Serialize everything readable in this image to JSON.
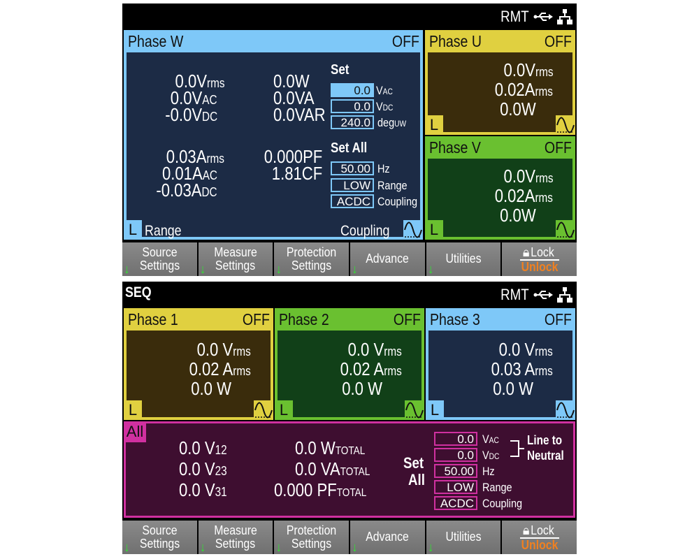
{
  "screen1": {
    "status": {
      "left": "",
      "remote": "RMT",
      "icons": [
        "usb-icon",
        "lan-icon"
      ]
    },
    "phase_w": {
      "title": "Phase W",
      "state": "OFF",
      "color": "#7ec8f8",
      "body_color": "#1c2b45",
      "voltage": [
        {
          "v": "0.0",
          "u": "V",
          "s": "rms"
        },
        {
          "v": "0.0",
          "u": "V",
          "s": "AC"
        },
        {
          "v": "-0.0",
          "u": "V",
          "s": "DC"
        }
      ],
      "power": [
        {
          "v": "0.0",
          "u": "W"
        },
        {
          "v": "0.0",
          "u": "VA"
        },
        {
          "v": "0.0",
          "u": "VAR"
        }
      ],
      "current": [
        {
          "v": "0.03",
          "u": "A",
          "s": "rms"
        },
        {
          "v": "0.01",
          "u": "A",
          "s": "AC"
        },
        {
          "v": "-0.03",
          "u": "A",
          "s": "DC"
        }
      ],
      "factors": [
        {
          "v": "0.000",
          "u": "PF"
        },
        {
          "v": "1.81",
          "u": "CF"
        }
      ],
      "set": {
        "title": "Set",
        "rows": [
          {
            "value": "0.0",
            "label": "V",
            "sub": "AC",
            "active": true
          },
          {
            "value": "0.0",
            "label": "V",
            "sub": "DC"
          },
          {
            "value": "240.0",
            "label": "deg",
            "sub": "UW"
          }
        ]
      },
      "set_all": {
        "title": "Set All",
        "rows": [
          {
            "value": "50.00",
            "label": "Hz"
          },
          {
            "value": "LOW",
            "label": "Range"
          },
          {
            "value": "ACDC",
            "label": "Coupling"
          }
        ]
      },
      "range_indicator": "L",
      "range_label": "Range",
      "coupling_label": "Coupling"
    },
    "phase_u": {
      "title": "Phase U",
      "state": "OFF",
      "color": "#e0d040",
      "body_color": "#3a2c0c",
      "lines": [
        {
          "v": "0.0",
          "u": "V",
          "s": "rms"
        },
        {
          "v": "0.02",
          "u": "A",
          "s": "rms"
        },
        {
          "v": "0.0",
          "u": "W",
          "s": ""
        }
      ],
      "range_indicator": "L"
    },
    "phase_v": {
      "title": "Phase V",
      "state": "OFF",
      "color": "#6ac030",
      "body_color": "#114018",
      "lines": [
        {
          "v": "0.0",
          "u": "V",
          "s": "rms"
        },
        {
          "v": "0.02",
          "u": "A",
          "s": "rms"
        },
        {
          "v": "0.0",
          "u": "W",
          "s": ""
        }
      ],
      "range_indicator": "L"
    },
    "softkeys": [
      {
        "line1": "Source",
        "line2": "Settings",
        "arrow": true
      },
      {
        "line1": "Measure",
        "line2": "Settings",
        "arrow": true
      },
      {
        "line1": "Protection",
        "line2": "Settings",
        "arrow": true
      },
      {
        "line1": "Advance",
        "line2": "",
        "arrow": true
      },
      {
        "line1": "Utilities",
        "line2": "",
        "arrow": true
      },
      {
        "line1": "Lock",
        "line2": "Unlock",
        "arrow": false
      }
    ]
  },
  "screen2": {
    "status": {
      "left": "SEQ",
      "remote": "RMT",
      "icons": [
        "usb-icon",
        "lan-icon"
      ]
    },
    "phases": [
      {
        "title": "Phase 1",
        "state": "OFF",
        "color": "#e0d040",
        "body_color": "#3a2c0c",
        "lines": [
          {
            "v": "0.0",
            "u": "V",
            "s": "rms"
          },
          {
            "v": "0.02",
            "u": "A",
            "s": "rms"
          },
          {
            "v": "0.0",
            "u": "W",
            "s": ""
          }
        ],
        "range_indicator": "L"
      },
      {
        "title": "Phase 2",
        "state": "OFF",
        "color": "#6ac030",
        "body_color": "#114018",
        "lines": [
          {
            "v": "0.0",
            "u": "V",
            "s": "rms"
          },
          {
            "v": "0.02",
            "u": "A",
            "s": "rms"
          },
          {
            "v": "0.0",
            "u": "W",
            "s": ""
          }
        ],
        "range_indicator": "L"
      },
      {
        "title": "Phase 3",
        "state": "OFF",
        "color": "#7ec8f8",
        "body_color": "#1c2b45",
        "lines": [
          {
            "v": "0.0",
            "u": "V",
            "s": "rms"
          },
          {
            "v": "0.03",
            "u": "A",
            "s": "rms"
          },
          {
            "v": "0.0",
            "u": "W",
            "s": ""
          }
        ],
        "range_indicator": "L"
      }
    ],
    "all": {
      "tag": "All",
      "color": "#d030a0",
      "body_color": "#3e0e30",
      "line_voltages": [
        {
          "v": "0.0",
          "u": "V",
          "s": "12"
        },
        {
          "v": "0.0",
          "u": "V",
          "s": "23"
        },
        {
          "v": "0.0",
          "u": "V",
          "s": "31"
        }
      ],
      "totals": [
        {
          "v": "0.0",
          "u": "W",
          "s": "TOTAL"
        },
        {
          "v": "0.0",
          "u": "VA",
          "s": "TOTAL"
        },
        {
          "v": "0.000",
          "u": "PF",
          "s": "TOTAL"
        }
      ],
      "set_all_title_1": "Set",
      "set_all_title_2": "All",
      "set_rows": [
        {
          "value": "0.0",
          "label": "V",
          "sub": "AC"
        },
        {
          "value": "0.0",
          "label": "V",
          "sub": "DC"
        },
        {
          "value": "50.00",
          "label": "Hz"
        },
        {
          "value": "LOW",
          "label": "Range"
        },
        {
          "value": "ACDC",
          "label": "Coupling"
        }
      ],
      "bracket_label_1": "Line to",
      "bracket_label_2": "Neutral"
    },
    "softkeys": [
      {
        "line1": "Source",
        "line2": "Settings",
        "arrow": true
      },
      {
        "line1": "Measure",
        "line2": "Settings",
        "arrow": true
      },
      {
        "line1": "Protection",
        "line2": "Settings",
        "arrow": true
      },
      {
        "line1": "Advance",
        "line2": "",
        "arrow": true
      },
      {
        "line1": "Utilities",
        "line2": "",
        "arrow": true
      },
      {
        "line1": "Lock",
        "line2": "Unlock",
        "arrow": false
      }
    ]
  }
}
